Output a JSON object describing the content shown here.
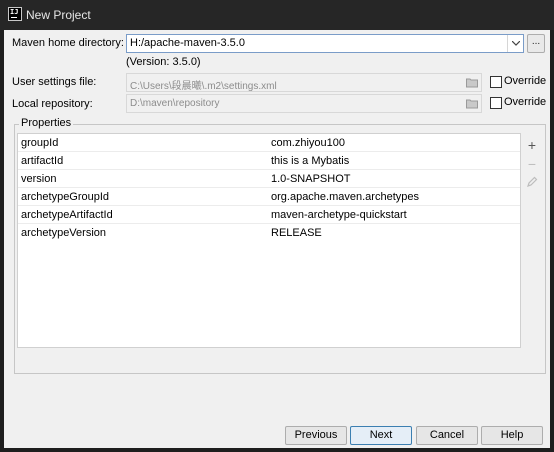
{
  "window": {
    "title": "New Project"
  },
  "maven_home": {
    "label": "Maven home directory:",
    "value": "H:/apache-maven-3.5.0",
    "version_note": "(Version: 3.5.0)",
    "browse_label": "..."
  },
  "user_settings": {
    "label": "User settings file:",
    "value": "C:\\Users\\段晨曦\\.m2\\settings.xml",
    "override_label": "Override"
  },
  "local_repository": {
    "label": "Local repository:",
    "value": "D:\\maven\\repository",
    "override_label": "Override"
  },
  "properties": {
    "title": "Properties",
    "rows": [
      {
        "key": "groupId",
        "value": "com.zhiyou100"
      },
      {
        "key": "artifactId",
        "value": "this is a Mybatis"
      },
      {
        "key": "version",
        "value": "1.0-SNAPSHOT"
      },
      {
        "key": "archetypeGroupId",
        "value": "org.apache.maven.archetypes"
      },
      {
        "key": "archetypeArtifactId",
        "value": "maven-archetype-quickstart"
      },
      {
        "key": "archetypeVersion",
        "value": "RELEASE"
      }
    ],
    "tools": {
      "add": "+",
      "remove": "−"
    }
  },
  "buttons": {
    "previous": "Previous",
    "next": "Next",
    "cancel": "Cancel",
    "help": "Help"
  },
  "colors": {
    "titlebar": "#262626",
    "panel": "#f0f0f0",
    "focus_border": "#7a9cc8"
  }
}
